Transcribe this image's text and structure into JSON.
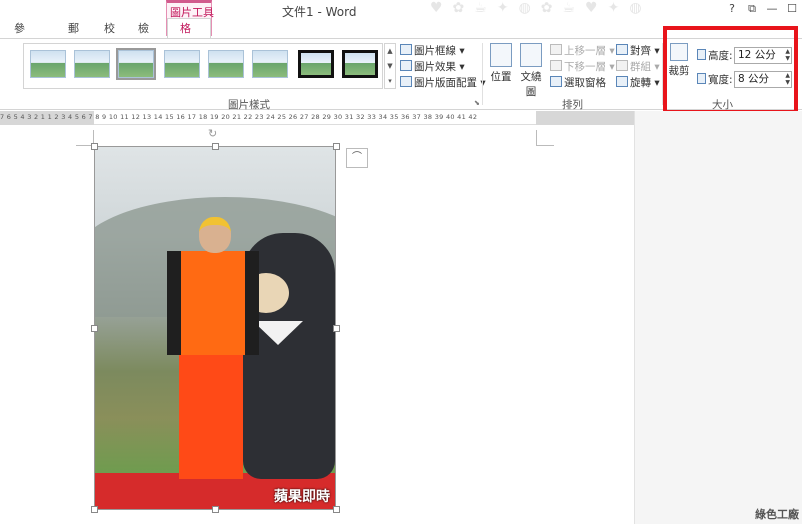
{
  "window": {
    "title": "文件1 - Word",
    "controls": [
      "?",
      "⧉",
      "—",
      "☐"
    ]
  },
  "context_tab_group": "圖片工具",
  "tabs": [
    {
      "label": "參考資料"
    },
    {
      "label": "郵件"
    },
    {
      "label": "校閱"
    },
    {
      "label": "檢視"
    },
    {
      "label": "格式",
      "active": true
    }
  ],
  "ribbon": {
    "picture_styles": {
      "label": "圖片樣式",
      "thumbnail_count": 8,
      "items": [
        {
          "label": "圖片框線"
        },
        {
          "label": "圖片效果"
        },
        {
          "label": "圖片版面配置"
        }
      ]
    },
    "arrange": {
      "label": "排列",
      "position": "位置",
      "wrap_text": "文繞圖",
      "bring_forward": "上移一層",
      "send_backward": "下移一層",
      "selection_pane": "選取窗格",
      "align": "對齊",
      "group": "群組",
      "rotate": "旋轉"
    },
    "size": {
      "label": "大小",
      "crop": "裁剪",
      "height_label": "高度:",
      "height_value": "12 公分",
      "width_label": "寬度:",
      "width_value": "8 公分"
    }
  },
  "ruler": {
    "text": "7 6 5 4 3 2 1   1 2 3 4 5 6 7 8 9 10 11 12 13 14 15 16 17 18 19 20 21 22 23 24 25 26 27 28 29 30 31 32 33 34 35 36 37 38 39 40 41 42"
  },
  "document": {
    "image_watermark": "蘋果即時"
  },
  "corner_watermark": "綠色工廠",
  "colors": {
    "accent": "#c2185b",
    "highlight": "#e8141b"
  }
}
